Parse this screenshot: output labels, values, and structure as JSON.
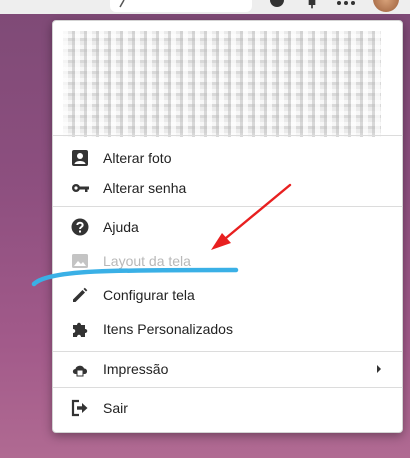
{
  "menu": {
    "items": [
      {
        "id": "alterar-foto",
        "label": "Alterar foto",
        "icon": "account-box-icon",
        "enabled": true
      },
      {
        "id": "alterar-senha",
        "label": "Alterar senha",
        "icon": "key-icon",
        "enabled": true
      },
      {
        "id": "ajuda",
        "label": "Ajuda",
        "icon": "help-circle-icon",
        "enabled": true
      },
      {
        "id": "layout-da-tela",
        "label": "Layout da tela",
        "icon": "image-icon",
        "enabled": false
      },
      {
        "id": "configurar-tela",
        "label": "Configurar tela",
        "icon": "pencil-icon",
        "enabled": true
      },
      {
        "id": "itens-personalizados",
        "label": "Itens Personalizados",
        "icon": "puzzle-icon",
        "enabled": true
      },
      {
        "id": "impressao",
        "label": "Impressão",
        "icon": "cloud-printer-icon",
        "enabled": true,
        "has_submenu": true
      },
      {
        "id": "sair",
        "label": "Sair",
        "icon": "logout-icon",
        "enabled": true
      }
    ]
  },
  "colors": {
    "annotation_arrow": "#e82020",
    "annotation_underline": "#3ab0e6"
  }
}
